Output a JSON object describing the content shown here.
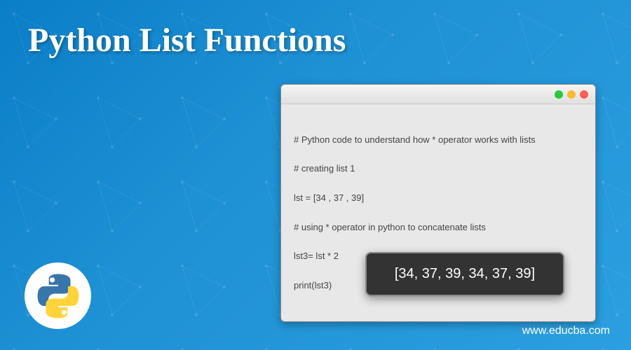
{
  "title": "Python List Functions",
  "code": {
    "line1": "# Python code to understand how * operator works with lists",
    "line2": "# creating list 1",
    "line3": "lst = [34 , 37 , 39]",
    "line4": "# using * operator in python to concatenate lists",
    "line5": "lst3= lst * 2",
    "line6": "print(lst3)"
  },
  "output": "[34, 37, 39, 34, 37, 39]",
  "watermark": "www.educba.com"
}
